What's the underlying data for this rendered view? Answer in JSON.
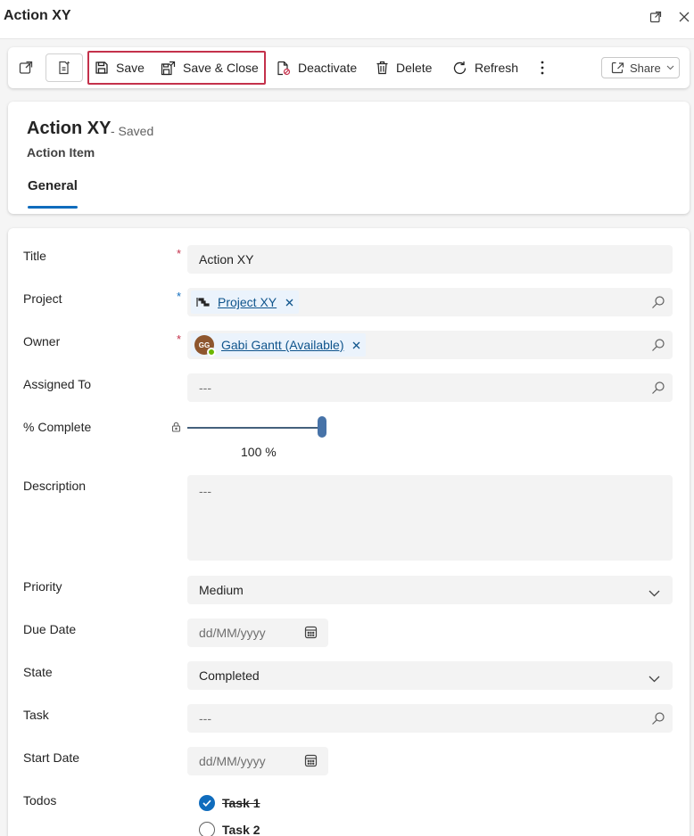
{
  "window": {
    "title": "Action XY"
  },
  "toolbar": {
    "save_label": "Save",
    "save_close_label": "Save & Close",
    "deactivate_label": "Deactivate",
    "delete_label": "Delete",
    "refresh_label": "Refresh",
    "share_label": "Share"
  },
  "header": {
    "record_title": "Action XY",
    "status": "- Saved",
    "entity": "Action Item",
    "tab_general": "General"
  },
  "form": {
    "title": {
      "label": "Title",
      "value": "Action XY"
    },
    "project": {
      "label": "Project",
      "value": "Project XY"
    },
    "owner": {
      "label": "Owner",
      "value": "Gabi Gantt (Available)",
      "initials": "GG"
    },
    "assigned_to": {
      "label": "Assigned To",
      "value": "---"
    },
    "percent_complete": {
      "label": "% Complete",
      "value": 100,
      "display": "100 %"
    },
    "description": {
      "label": "Description",
      "value": "---"
    },
    "priority": {
      "label": "Priority",
      "value": "Medium"
    },
    "due_date": {
      "label": "Due Date",
      "placeholder": "dd/MM/yyyy"
    },
    "state": {
      "label": "State",
      "value": "Completed"
    },
    "task": {
      "label": "Task",
      "value": "---"
    },
    "start_date": {
      "label": "Start Date",
      "placeholder": "dd/MM/yyyy"
    },
    "todos": {
      "label": "Todos",
      "items": [
        {
          "label": "Task 1",
          "checked": true
        },
        {
          "label": "Task 2",
          "checked": false
        }
      ]
    }
  },
  "colors": {
    "accent": "#0f6cbd",
    "required": "#c4314b",
    "highlight": "#c4314b",
    "presence": "#6bb700"
  }
}
